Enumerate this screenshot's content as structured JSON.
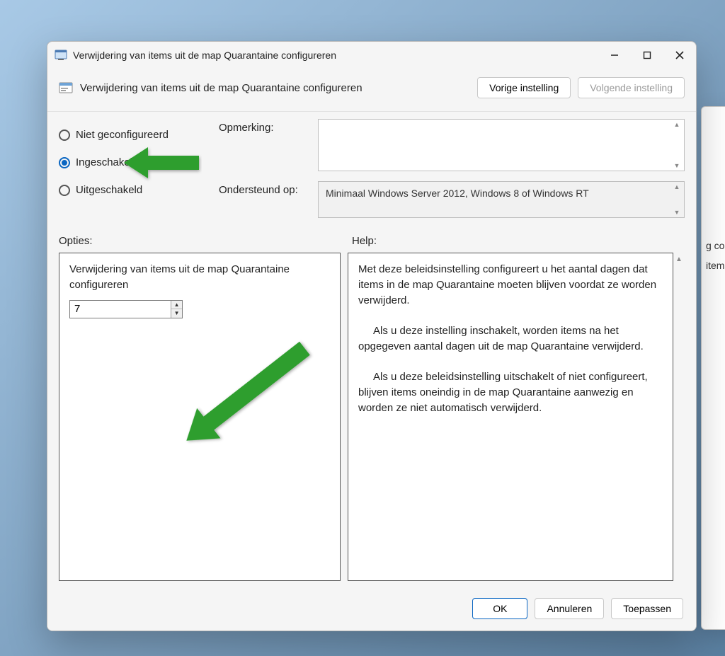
{
  "window": {
    "title": "Verwijdering van items uit de map Quarantaine configureren"
  },
  "policybar": {
    "title": "Verwijdering van items uit de map Quarantaine configureren",
    "prev_label": "Vorige instelling",
    "next_label": "Volgende instelling"
  },
  "radios": {
    "not_configured": "Niet geconfigureerd",
    "enabled": "Ingeschakeld",
    "disabled": "Uitgeschakeld",
    "selected": "enabled"
  },
  "fields": {
    "comment_label": "Opmerking:",
    "comment_value": "",
    "supported_label": "Ondersteund op:",
    "supported_value": "Minimaal Windows Server 2012, Windows 8 of Windows RT"
  },
  "sections": {
    "options_label": "Opties:",
    "help_label": "Help:"
  },
  "options": {
    "setting_name": "Verwijdering van items uit de map Quarantaine configureren",
    "days_value": "7"
  },
  "help": {
    "p1": "Met deze beleidsinstelling configureert u het aantal dagen dat items in de map Quarantaine moeten blijven voordat ze worden verwijderd.",
    "p2": "Als u deze instelling inschakelt, worden items na het opgegeven aantal dagen uit de map Quarantaine verwijderd.",
    "p3": "Als u deze beleidsinstelling uitschakelt of niet configureert, blijven items oneindig in de map Quarantaine aanwezig en worden ze niet automatisch verwijderd."
  },
  "footer": {
    "ok": "OK",
    "cancel": "Annuleren",
    "apply": "Toepassen"
  },
  "behind": {
    "line1": "g conf",
    "line2": "items u"
  }
}
